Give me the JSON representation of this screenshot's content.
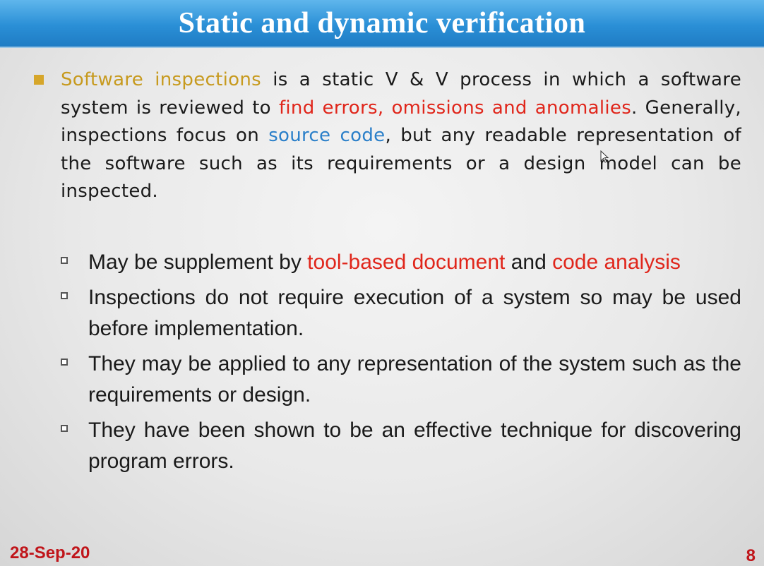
{
  "slide": {
    "title": "Static and dynamic verification",
    "paragraph": {
      "highlight": "Software inspections",
      "t1": " is a static V & V process in which a software system is reviewed to ",
      "red1": "find errors, omissions and anomalies",
      "t2": ". Generally, inspections focus on ",
      "blue1": "source code",
      "t3": ", but any readable representation of the software such as its requirements or a design model can be inspected."
    },
    "sub_items": [
      {
        "t1": "May be supplement by ",
        "red1": "tool-based document",
        "t2": " and ",
        "red2": "code analysis"
      },
      {
        "text": "Inspections do not require execution of a system so may be used before implementation."
      },
      {
        "text": "They may be applied to any representation of the system such as the requirements or design."
      },
      {
        "text": "They have been shown to be an effective technique for discovering program errors."
      }
    ],
    "footer": {
      "date": "28-Sep-20",
      "page": "8"
    }
  },
  "colors": {
    "title_bar": "#2a8fd6",
    "highlight_gold": "#c79a1e",
    "emphasis_red": "#e0261b",
    "emphasis_blue": "#2a7fc9",
    "footer_red": "#c0151a"
  },
  "icons": {
    "main_bullet": "square-bullet-icon",
    "sub_bullet": "hollow-square-bullet-icon",
    "cursor": "mouse-pointer-icon"
  }
}
